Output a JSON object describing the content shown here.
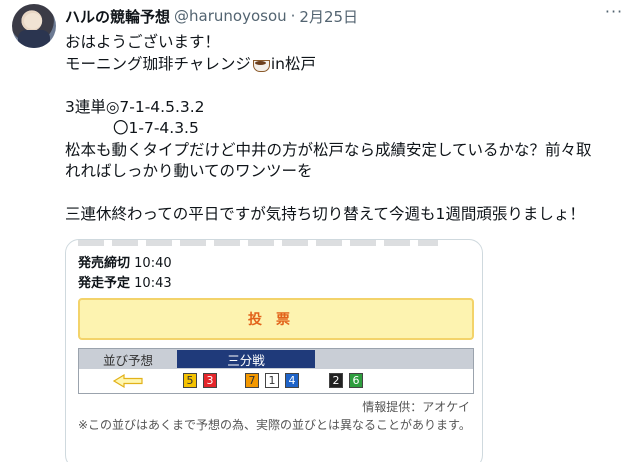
{
  "tweet": {
    "display_name": "ハルの競輪予想",
    "handle": "@harunoyosou",
    "separator": "·",
    "date": "2月25日",
    "more_icon": "ellipsis-icon",
    "lines": [
      "おはようございます！",
      "モーニング珈琲チャレンジ",
      "in松戸",
      "",
      "3連単◎7-1-4.5.3.2",
      "〇1-7-4.3.5",
      "松本も動くタイプだけど中井の方が松戸なら成績安定しているかな？前々取",
      "れればしっかり動いてのワンツーを",
      "",
      "三連休終わっての平日ですが気持ち切り替えて今週も1週間頑張りましょ！"
    ]
  },
  "card": {
    "deadline_label": "発売締切",
    "deadline_time": "10:40",
    "start_label": "発走予定",
    "start_time": "10:43",
    "vote_button": "投票",
    "lineup_label": "並び予想",
    "lineup_tab": "三分戦",
    "lineup_groups": [
      [
        "5",
        "3"
      ],
      [
        "7",
        "1",
        "4"
      ],
      [
        "2",
        "6"
      ]
    ],
    "source": "情報提供：アオケイ",
    "disclaimer": "※この並びはあくまで予想の為、実際の並びとは異なることがあります。"
  },
  "colors": {
    "accent": "#1f3a7a",
    "vote_bg": "#fdf3b0",
    "vote_text": "#e2631a",
    "post_5": "#f5c200",
    "post_3": "#e5262b",
    "post_7": "#f39800",
    "post_1": "#ffffff",
    "post_4": "#1e63c8",
    "post_2": "#222222",
    "post_6": "#2e9e3e"
  }
}
